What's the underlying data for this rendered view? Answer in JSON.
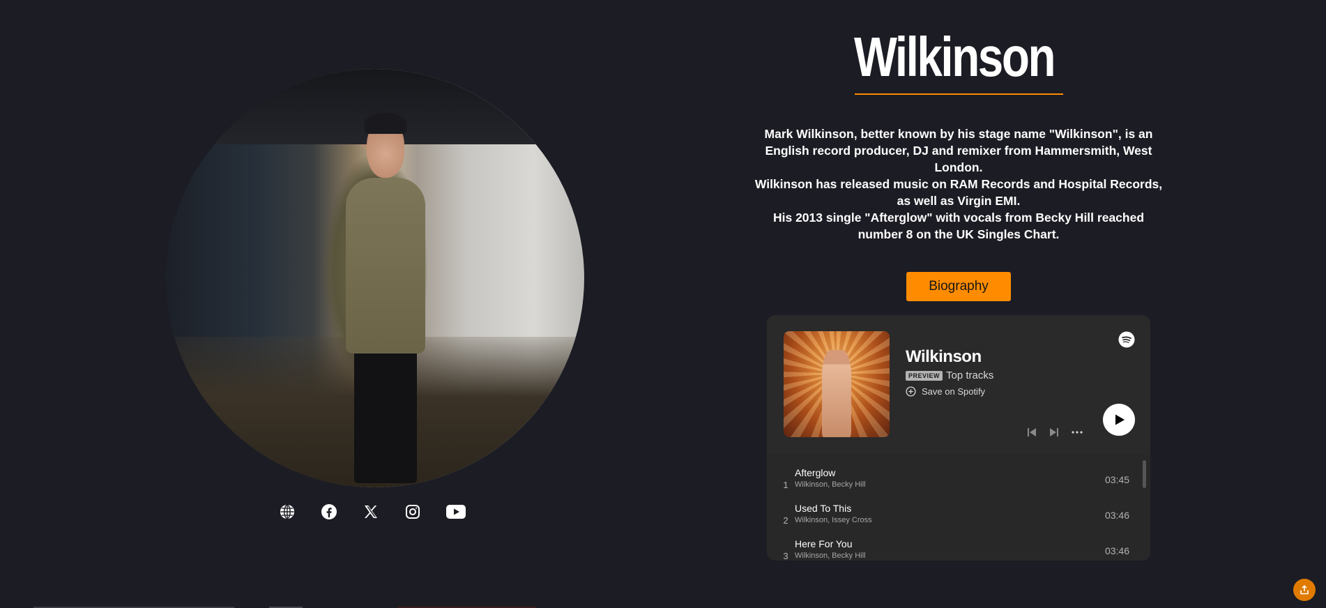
{
  "artist": {
    "name": "Wilkinson",
    "bio_lines": [
      "Mark Wilkinson, better known by his stage name \"Wilkinson\", is an English record producer, DJ and remixer from Hammersmith, West London.",
      "Wilkinson has released music on RAM Records and Hospital Records, as well as Virgin EMI.",
      "His 2013 single \"Afterglow\" with vocals from Becky Hill reached number 8 on the UK Singles Chart."
    ],
    "biography_button": "Biography"
  },
  "socials": [
    {
      "icon": "globe-icon"
    },
    {
      "icon": "facebook-icon"
    },
    {
      "icon": "x-twitter-icon"
    },
    {
      "icon": "instagram-icon"
    },
    {
      "icon": "youtube-icon"
    }
  ],
  "spotify": {
    "artist": "Wilkinson",
    "badge": "PREVIEW",
    "subtitle": "Top tracks",
    "save_label": "Save on Spotify",
    "tracks": [
      {
        "num": "1",
        "title": "Afterglow",
        "artists": "Wilkinson, Becky Hill",
        "duration": "03:45"
      },
      {
        "num": "2",
        "title": "Used To This",
        "artists": "Wilkinson, Issey Cross",
        "duration": "03:46"
      },
      {
        "num": "3",
        "title": "Here For You",
        "artists": "Wilkinson, Becky Hill",
        "duration": "03:46"
      }
    ]
  },
  "colors": {
    "background": "#1c1c24",
    "accent": "#ff8c00",
    "embed_bg": "#282828"
  }
}
